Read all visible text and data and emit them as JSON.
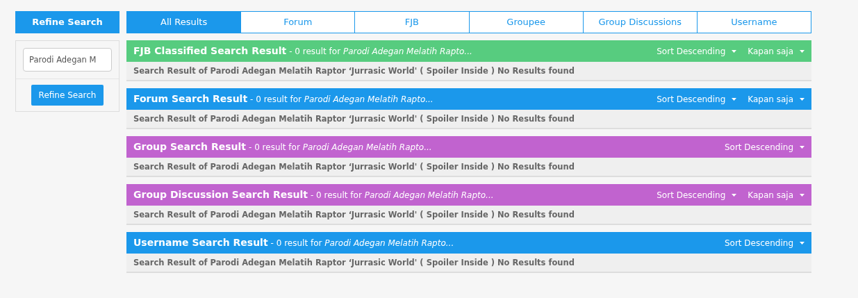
{
  "sidebar": {
    "title": "Refine Search",
    "search": {
      "value": "Parodi Adegan M"
    },
    "button": "Refine Search"
  },
  "tabs": [
    {
      "label": "All Results",
      "selected": true
    },
    {
      "label": "Forum",
      "selected": false
    },
    {
      "label": "FJB",
      "selected": false
    },
    {
      "label": "Groupee",
      "selected": false
    },
    {
      "label": "Group Discussions",
      "selected": false
    },
    {
      "label": "Username",
      "selected": false
    }
  ],
  "sections": [
    {
      "title": "FJB Classified Search Result",
      "summary": "- 0 result for *Parodi Adegan Melatih Rapto...*",
      "color": "#57cc7f",
      "dropdowns": [
        "Sort Descending",
        "Kapan saja"
      ],
      "message": "Search Result of Parodi Adegan Melatih Raptor ‘Jurrasic World' ( Spoiler Inside ) No Results found"
    },
    {
      "title": "Forum Search Result",
      "summary": "- 0 result for *Parodi Adegan Melatih Rapto...*",
      "color": "#1b98eb",
      "dropdowns": [
        "Sort Descending",
        "Kapan saja"
      ],
      "message": "Search Result of Parodi Adegan Melatih Raptor ‘Jurrasic World' ( Spoiler Inside ) No Results found"
    },
    {
      "title": "Group Search Result",
      "summary": "- 0 result for *Parodi Adegan Melatih Rapto...*",
      "color": "#c163cf",
      "dropdowns": [
        "Sort Descending"
      ],
      "message": "Search Result of Parodi Adegan Melatih Raptor ‘Jurrasic World' ( Spoiler Inside ) No Results found"
    },
    {
      "title": "Group Discussion Search Result",
      "summary": "- 0 result for *Parodi Adegan Melatih Rapto...*",
      "color": "#c163cf",
      "dropdowns": [
        "Sort Descending",
        "Kapan saja"
      ],
      "message": "Search Result of Parodi Adegan Melatih Raptor ‘Jurrasic World' ( Spoiler Inside ) No Results found"
    },
    {
      "title": "Username Search Result",
      "summary": "- 0 result for *Parodi Adegan Melatih Rapto...*",
      "color": "#1b98eb",
      "dropdowns": [
        "Sort Descending"
      ],
      "message": "Search Result of Parodi Adegan Melatih Raptor ‘Jurrasic World' ( Spoiler Inside ) No Results found"
    }
  ]
}
